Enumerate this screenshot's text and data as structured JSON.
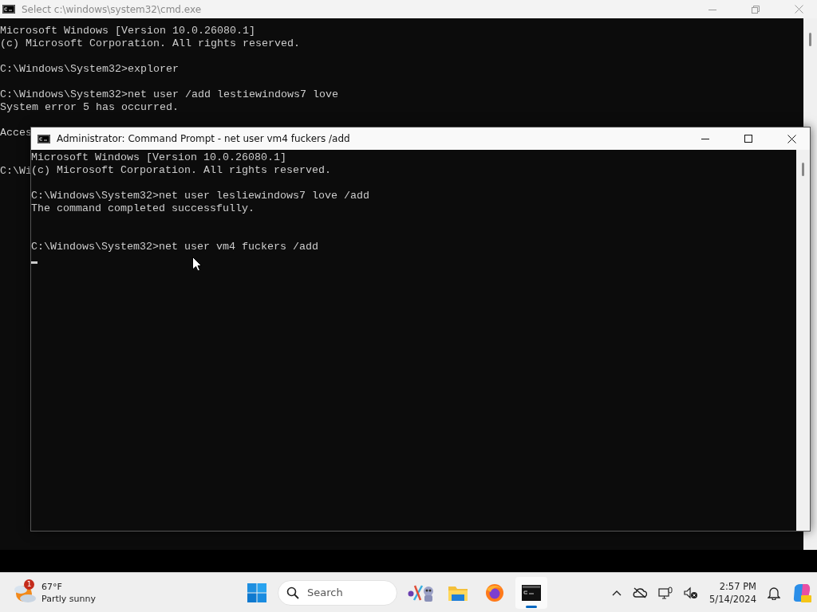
{
  "back_window": {
    "title": "Select c:\\windows\\system32\\cmd.exe",
    "active": false,
    "lines": [
      {
        "kind": "text",
        "text": "Microsoft Windows [Version 10.0.26080.1]"
      },
      {
        "kind": "text",
        "text": "(c) Microsoft Corporation. All rights reserved."
      },
      {
        "kind": "blank"
      },
      {
        "kind": "text",
        "text": "C:\\Windows\\System32>explorer"
      },
      {
        "kind": "blank"
      },
      {
        "kind": "text",
        "text": "C:\\Windows\\System32>net user /add lestiewindows7 love"
      },
      {
        "kind": "text",
        "text": "System error 5 has occurred."
      },
      {
        "kind": "blank"
      },
      {
        "kind": "text",
        "text": "Acces"
      },
      {
        "kind": "blank"
      },
      {
        "kind": "blank"
      },
      {
        "kind": "text",
        "text": "C:\\Wi"
      }
    ]
  },
  "front_window": {
    "title": "Administrator: Command Prompt - net  user vm4 fuckers /add",
    "active": true,
    "lines": [
      {
        "kind": "text",
        "text": "Microsoft Windows [Version 10.0.26080.1]"
      },
      {
        "kind": "text",
        "text": "(c) Microsoft Corporation. All rights reserved."
      },
      {
        "kind": "blank"
      },
      {
        "kind": "text",
        "text": "C:\\Windows\\System32>net user lesliewindows7 love /add"
      },
      {
        "kind": "text",
        "text": "The command completed successfully."
      },
      {
        "kind": "blank"
      },
      {
        "kind": "blank"
      },
      {
        "kind": "text",
        "text": "C:\\Windows\\System32>net user vm4 fuckers /add"
      },
      {
        "kind": "cursor"
      }
    ]
  },
  "taskbar": {
    "weather": {
      "badge": "1",
      "temperature": "67°F",
      "condition": "Partly sunny"
    },
    "search": {
      "placeholder": "Search"
    },
    "apps": [
      {
        "kind": "start",
        "selected": false
      },
      {
        "kind": "search"
      },
      {
        "kind": "mascot",
        "selected": false
      },
      {
        "kind": "folder",
        "selected": false
      },
      {
        "kind": "browser",
        "selected": false
      },
      {
        "kind": "terminal",
        "selected": true
      }
    ],
    "clock": {
      "time": "2:57 PM",
      "date": "5/14/2024"
    }
  }
}
